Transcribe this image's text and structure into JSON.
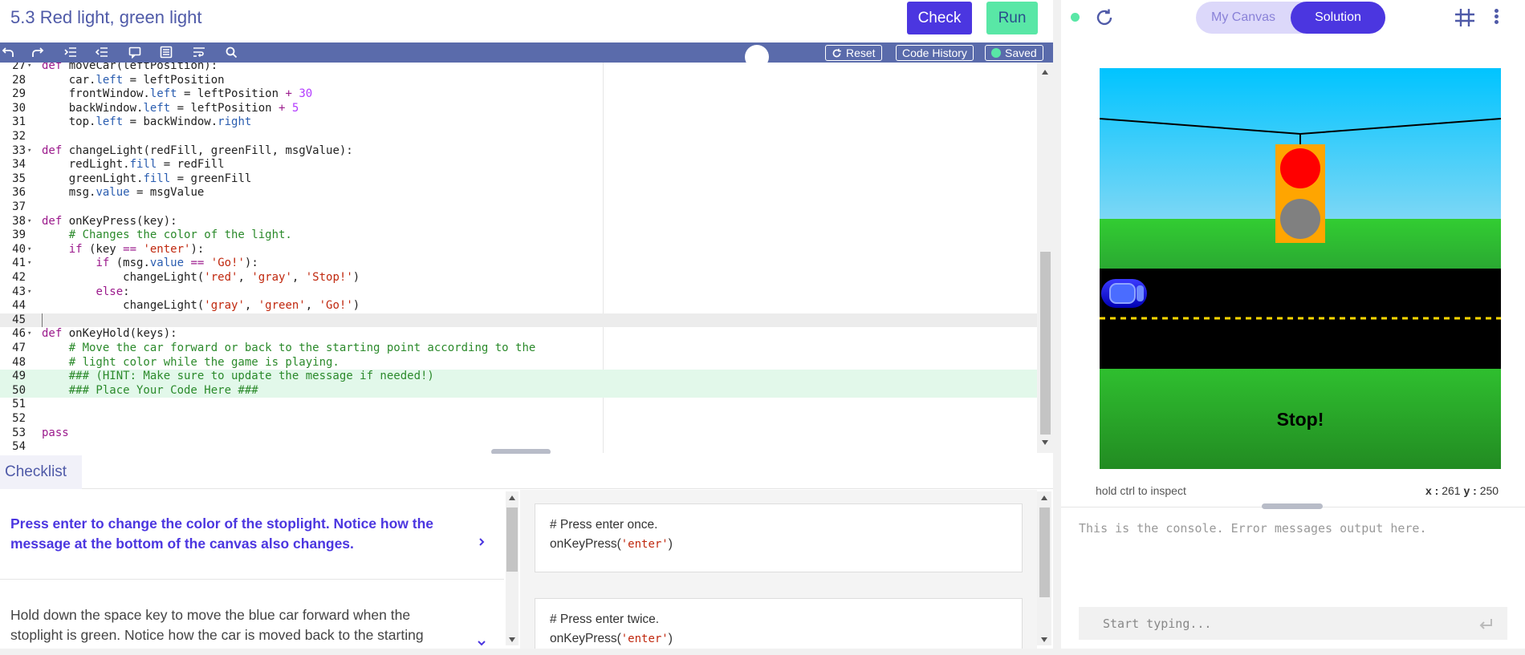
{
  "header": {
    "title": "5.3 Red light, green light",
    "check_label": "Check",
    "run_label": "Run"
  },
  "toolbar": {
    "icons": [
      "undo-icon",
      "redo-icon",
      "indent-icon",
      "outdent-icon",
      "comment-icon",
      "format-icon",
      "wrap-icon",
      "search-icon"
    ],
    "reset_label": "Reset",
    "history_label": "Code History",
    "saved_label": "Saved"
  },
  "editor": {
    "lines": [
      {
        "n": "27",
        "fold": true,
        "parts": [
          [
            "kw",
            "def"
          ],
          [
            "t",
            " moveCar(leftPosition):"
          ]
        ]
      },
      {
        "n": "28",
        "parts": [
          [
            "t",
            "    car."
          ],
          [
            "prop",
            "left"
          ],
          [
            "t",
            " = leftPosition"
          ]
        ]
      },
      {
        "n": "29",
        "parts": [
          [
            "t",
            "    frontWindow."
          ],
          [
            "prop",
            "left"
          ],
          [
            "t",
            " = leftPosition "
          ],
          [
            "kw",
            "+"
          ],
          [
            "t",
            " "
          ],
          [
            "num",
            "30"
          ]
        ]
      },
      {
        "n": "30",
        "parts": [
          [
            "t",
            "    backWindow."
          ],
          [
            "prop",
            "left"
          ],
          [
            "t",
            " = leftPosition "
          ],
          [
            "kw",
            "+"
          ],
          [
            "t",
            " "
          ],
          [
            "num",
            "5"
          ]
        ]
      },
      {
        "n": "31",
        "parts": [
          [
            "t",
            "    top."
          ],
          [
            "prop",
            "left"
          ],
          [
            "t",
            " = backWindow."
          ],
          [
            "prop",
            "right"
          ]
        ]
      },
      {
        "n": "32",
        "parts": []
      },
      {
        "n": "33",
        "fold": true,
        "parts": [
          [
            "kw",
            "def"
          ],
          [
            "t",
            " changeLight(redFill, greenFill, msgValue):"
          ]
        ]
      },
      {
        "n": "34",
        "parts": [
          [
            "t",
            "    redLight."
          ],
          [
            "prop",
            "fill"
          ],
          [
            "t",
            " = redFill"
          ]
        ]
      },
      {
        "n": "35",
        "parts": [
          [
            "t",
            "    greenLight."
          ],
          [
            "prop",
            "fill"
          ],
          [
            "t",
            " = greenFill"
          ]
        ]
      },
      {
        "n": "36",
        "parts": [
          [
            "t",
            "    msg."
          ],
          [
            "prop",
            "value"
          ],
          [
            "t",
            " = msgValue"
          ]
        ]
      },
      {
        "n": "37",
        "parts": []
      },
      {
        "n": "38",
        "fold": true,
        "parts": [
          [
            "kw",
            "def"
          ],
          [
            "t",
            " onKeyPress(key):"
          ]
        ]
      },
      {
        "n": "39",
        "parts": [
          [
            "cm",
            "    # Changes the color of the light."
          ]
        ]
      },
      {
        "n": "40",
        "fold": true,
        "parts": [
          [
            "t",
            "    "
          ],
          [
            "kw",
            "if"
          ],
          [
            "t",
            " (key "
          ],
          [
            "kw",
            "=="
          ],
          [
            "t",
            " "
          ],
          [
            "str",
            "'enter'"
          ],
          [
            "t",
            "):"
          ]
        ]
      },
      {
        "n": "41",
        "fold": true,
        "parts": [
          [
            "t",
            "        "
          ],
          [
            "kw",
            "if"
          ],
          [
            "t",
            " (msg."
          ],
          [
            "prop",
            "value"
          ],
          [
            "t",
            " "
          ],
          [
            "kw",
            "=="
          ],
          [
            "t",
            " "
          ],
          [
            "str",
            "'Go!'"
          ],
          [
            "t",
            "):"
          ]
        ]
      },
      {
        "n": "42",
        "parts": [
          [
            "t",
            "            changeLight("
          ],
          [
            "str",
            "'red'"
          ],
          [
            "t",
            ", "
          ],
          [
            "str",
            "'gray'"
          ],
          [
            "t",
            ", "
          ],
          [
            "str",
            "'Stop!'"
          ],
          [
            "t",
            ")"
          ]
        ]
      },
      {
        "n": "43",
        "fold": true,
        "parts": [
          [
            "t",
            "        "
          ],
          [
            "kw",
            "else"
          ],
          [
            "t",
            ":"
          ]
        ]
      },
      {
        "n": "44",
        "parts": [
          [
            "t",
            "            changeLight("
          ],
          [
            "str",
            "'gray'"
          ],
          [
            "t",
            ", "
          ],
          [
            "str",
            "'green'"
          ],
          [
            "t",
            ", "
          ],
          [
            "str",
            "'Go!'"
          ],
          [
            "t",
            ")"
          ]
        ]
      },
      {
        "n": "45",
        "current": true,
        "parts": []
      },
      {
        "n": "46",
        "fold": true,
        "parts": [
          [
            "kw",
            "def"
          ],
          [
            "t",
            " onKeyHold(keys):"
          ]
        ]
      },
      {
        "n": "47",
        "parts": [
          [
            "cm",
            "    # Move the car forward or back to the starting point according to the"
          ]
        ]
      },
      {
        "n": "48",
        "parts": [
          [
            "cm",
            "    # light color while the game is playing."
          ]
        ]
      },
      {
        "n": "49",
        "hl": true,
        "parts": [
          [
            "cm",
            "    ### (HINT: Make sure to update the message if needed!)"
          ]
        ]
      },
      {
        "n": "50",
        "hl": true,
        "parts": [
          [
            "cm",
            "    ### Place Your Code Here ###"
          ]
        ]
      },
      {
        "n": "51",
        "parts": []
      },
      {
        "n": "52",
        "parts": []
      },
      {
        "n": "53",
        "parts": [
          [
            "kw",
            "pass"
          ]
        ]
      },
      {
        "n": "54",
        "parts": []
      }
    ]
  },
  "checklist": {
    "tab_label": "Checklist",
    "items": [
      {
        "text": "Press enter to change the color of the stoplight. Notice how the message at the bottom of the canvas also changes.",
        "chevron": "chevron-right-icon"
      },
      {
        "text": "Hold down the space key to move the blue car forward when the stoplight is green. Notice how the car is moved back to the starting",
        "chevron": "chevron-down-icon"
      }
    ],
    "tests": [
      {
        "comment": "# Press enter once.",
        "call": "onKeyPress(",
        "arg": "'enter'",
        "close": ")"
      },
      {
        "comment": "# Press enter twice.",
        "call": "onKeyPress(",
        "arg": "'enter'",
        "close": ")"
      }
    ]
  },
  "right": {
    "toggle_mine": "My Canvas",
    "toggle_solution": "Solution",
    "canvas_message": "Stop!",
    "inspect_hint": "hold ctrl to inspect",
    "x_label": "x :",
    "x_value": "261",
    "y_label": "y :",
    "y_value": "250",
    "console_text": "This is the console. Error messages output here.",
    "console_placeholder": "Start typing..."
  },
  "colors": {
    "accent": "#4b36e0",
    "run": "#59e7a6",
    "toolbar": "#5a6bab",
    "title": "#4f5aa8"
  }
}
